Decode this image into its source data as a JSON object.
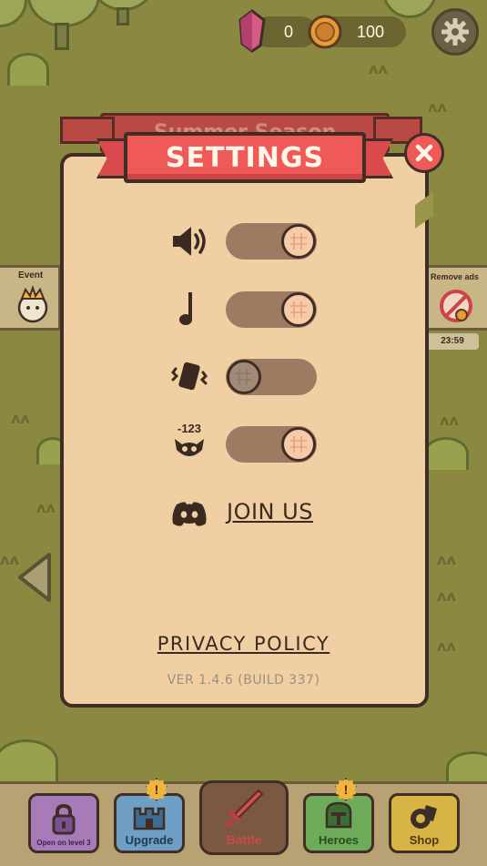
{
  "hud": {
    "gems": "0",
    "coins": "100",
    "settings_icon": "gear-icon"
  },
  "side": {
    "event_label": "Event",
    "remove_ads_label": "Remove ads",
    "remove_ads_timer": "23:59"
  },
  "dialog": {
    "background_ribbon_text": "Summer Season",
    "title": "SETTINGS",
    "close_icon": "close-icon",
    "rows": [
      {
        "icon": "speaker-icon",
        "setting": "sound",
        "enabled": true
      },
      {
        "icon": "music-note-icon",
        "setting": "music",
        "enabled": true
      },
      {
        "icon": "vibration-icon",
        "setting": "vibration",
        "enabled": false
      },
      {
        "icon": "damage-numbers-icon",
        "icon_text": "-123",
        "setting": "damage numbers",
        "enabled": true
      }
    ],
    "discord_icon": "discord-icon",
    "join_us": "JOIN US",
    "privacy_policy": "PRIVACY POLICY",
    "version": "VER 1.4.6 (BUILD 337)"
  },
  "nav": {
    "locked_label": "Open on level 3",
    "upgrade": "Upgrade",
    "upgrade_badge": "!",
    "battle": "Battle",
    "heroes": "Heroes",
    "heroes_badge": "!",
    "shop": "Shop"
  },
  "colors": {
    "panel": "#f0cfa2",
    "ribbon": "#ef5a59",
    "toggle_track": "#9c7b62",
    "knob_on": "#f7cba8",
    "knob_off": "#a18a77",
    "outline": "#3f2e25"
  }
}
